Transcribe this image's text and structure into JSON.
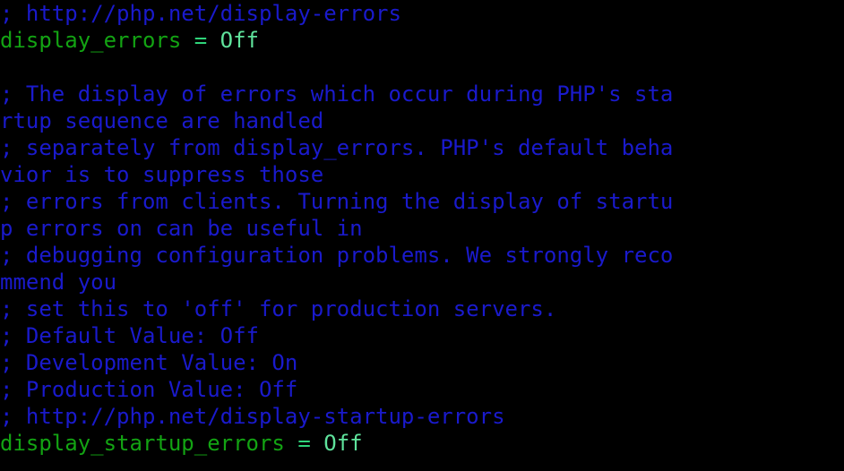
{
  "terminal": {
    "app": "terminal",
    "file": "php.ini",
    "background_color": "#000000",
    "font_size_px": 24,
    "line_height_px": 30,
    "columns": 52,
    "colors": {
      "comment": "#1a1acc",
      "directive_key": "#13a313",
      "operator": "#2fd47a",
      "value": "#5fe39c",
      "background": "#000000"
    },
    "lines": [
      {
        "id": "line-1",
        "kind": "comment",
        "text": "; http://php.net/display-errors",
        "tokens": [
          {
            "cls": "comment",
            "text": "; http://php.net/display-errors"
          }
        ]
      },
      {
        "id": "line-2",
        "kind": "directive",
        "text": "display_errors = Off",
        "tokens": [
          {
            "cls": "key",
            "text": "display_errors "
          },
          {
            "cls": "operator",
            "text": "="
          },
          {
            "cls": "value",
            "text": " Off"
          }
        ]
      },
      {
        "id": "line-3",
        "kind": "blank",
        "text": "",
        "tokens": [
          {
            "cls": "blank",
            "text": " "
          }
        ]
      },
      {
        "id": "line-4",
        "kind": "comment",
        "text": "; The display of errors which occur during PHP's sta",
        "tokens": [
          {
            "cls": "comment",
            "text": "; The display of errors which occur during PHP's sta"
          }
        ]
      },
      {
        "id": "line-5",
        "kind": "comment-wrap",
        "text": "rtup sequence are handled",
        "tokens": [
          {
            "cls": "comment",
            "text": "rtup sequence are handled"
          }
        ]
      },
      {
        "id": "line-6",
        "kind": "comment",
        "text": "; separately from display_errors. PHP's default beha",
        "tokens": [
          {
            "cls": "comment",
            "text": "; separately from display_errors. PHP's default beha"
          }
        ]
      },
      {
        "id": "line-7",
        "kind": "comment-wrap",
        "text": "vior is to suppress those",
        "tokens": [
          {
            "cls": "comment",
            "text": "vior is to suppress those"
          }
        ]
      },
      {
        "id": "line-8",
        "kind": "comment",
        "text": "; errors from clients. Turning the display of startu",
        "tokens": [
          {
            "cls": "comment",
            "text": "; errors from clients. Turning the display of startu"
          }
        ]
      },
      {
        "id": "line-9",
        "kind": "comment-wrap",
        "text": "p errors on can be useful in",
        "tokens": [
          {
            "cls": "comment",
            "text": "p errors on can be useful in"
          }
        ]
      },
      {
        "id": "line-10",
        "kind": "comment",
        "text": "; debugging configuration problems. We strongly reco",
        "tokens": [
          {
            "cls": "comment",
            "text": "; debugging configuration problems. We strongly reco"
          }
        ]
      },
      {
        "id": "line-11",
        "kind": "comment-wrap",
        "text": "mmend you",
        "tokens": [
          {
            "cls": "comment",
            "text": "mmend you"
          }
        ]
      },
      {
        "id": "line-12",
        "kind": "comment",
        "text": "; set this to 'off' for production servers.",
        "tokens": [
          {
            "cls": "comment",
            "text": "; set this to 'off' for production servers."
          }
        ]
      },
      {
        "id": "line-13",
        "kind": "comment",
        "text": "; Default Value: Off",
        "tokens": [
          {
            "cls": "comment",
            "text": "; Default Value: Off"
          }
        ]
      },
      {
        "id": "line-14",
        "kind": "comment",
        "text": "; Development Value: On",
        "tokens": [
          {
            "cls": "comment",
            "text": "; Development Value: On"
          }
        ]
      },
      {
        "id": "line-15",
        "kind": "comment",
        "text": "; Production Value: Off",
        "tokens": [
          {
            "cls": "comment",
            "text": "; Production Value: Off"
          }
        ]
      },
      {
        "id": "line-16",
        "kind": "comment",
        "text": "; http://php.net/display-startup-errors",
        "tokens": [
          {
            "cls": "comment",
            "text": "; http://php.net/display-startup-errors"
          }
        ]
      },
      {
        "id": "line-17",
        "kind": "directive",
        "text": "display_startup_errors = Off",
        "tokens": [
          {
            "cls": "key",
            "text": "display_startup_errors "
          },
          {
            "cls": "operator",
            "text": "="
          },
          {
            "cls": "value",
            "text": " Off"
          }
        ]
      }
    ]
  }
}
